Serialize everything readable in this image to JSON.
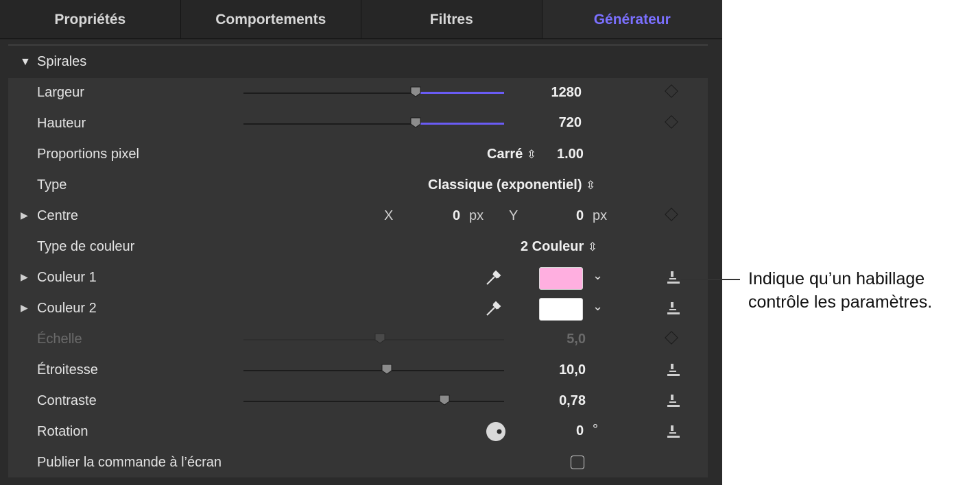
{
  "tabs": [
    {
      "label": "Propriétés"
    },
    {
      "label": "Comportements"
    },
    {
      "label": "Filtres"
    },
    {
      "label": "Générateur"
    }
  ],
  "group": {
    "label": "Spirales"
  },
  "rows": {
    "largeur": {
      "label": "Largeur",
      "value": "1280",
      "slider_fraction": 0.66
    },
    "hauteur": {
      "label": "Hauteur",
      "value": "720",
      "slider_fraction": 0.66
    },
    "proportions": {
      "label": "Proportions pixel",
      "mode": "Carré",
      "value": "1.00"
    },
    "type": {
      "label": "Type",
      "value": "Classique (exponentiel)"
    },
    "centre": {
      "label": "Centre",
      "x_label": "X",
      "x_value": "0",
      "x_unit": "px",
      "y_label": "Y",
      "y_value": "0",
      "y_unit": "px"
    },
    "type_couleur": {
      "label": "Type de couleur",
      "value": "2 Couleur"
    },
    "couleur1": {
      "label": "Couleur 1",
      "color": "#ffafe0"
    },
    "couleur2": {
      "label": "Couleur 2",
      "color": "#ffffff"
    },
    "echelle": {
      "label": "Échelle",
      "value": "5,0",
      "slider_fraction": 0.52
    },
    "etroitesse": {
      "label": "Étroitesse",
      "value": "10,0",
      "slider_fraction": 0.55
    },
    "contraste": {
      "label": "Contraste",
      "value": "0,78",
      "slider_fraction": 0.77
    },
    "rotation": {
      "label": "Rotation",
      "value": "0",
      "unit": "°"
    },
    "publier": {
      "label": "Publier la commande à l’écran",
      "checked": false
    }
  },
  "colors": {
    "accent": "#7b70ff",
    "slider_fill": "#6a5cf5",
    "panel_bg": "#2b2b2b",
    "row_bg": "#353535"
  },
  "callout": {
    "text": "Indique qu’un habillage contrôle les paramètres."
  }
}
